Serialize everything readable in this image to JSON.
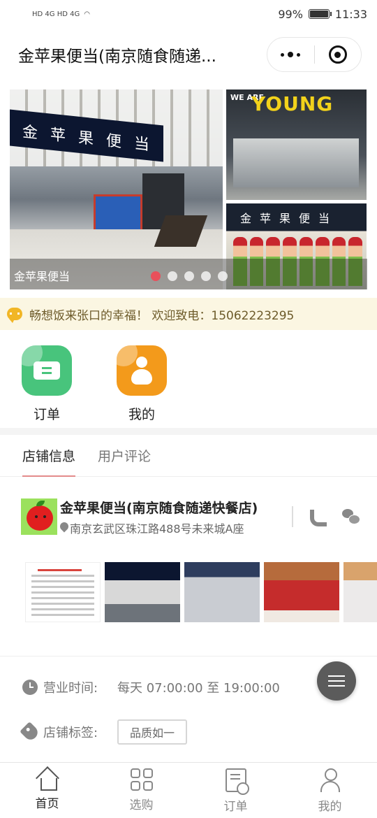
{
  "status_bar": {
    "carrier_left": "HD 4G HD 4G",
    "battery": "99%",
    "battery_level": 0.99,
    "time": "11:33"
  },
  "nav": {
    "title": "金苹果便当(南京随食随递..."
  },
  "banner": {
    "caption": "金苹果便当",
    "sign_text": "金苹果便当",
    "young_prefix": "WE ARE",
    "young_word": "YOUNG",
    "slide_count": 5,
    "active_slide": 1
  },
  "notice": {
    "text": "畅想饭来张口的幸福！ 欢迎致电：15062223295"
  },
  "quick_actions": [
    {
      "label": "订单",
      "icon": "ticket-icon"
    },
    {
      "label": "我的",
      "icon": "person-icon"
    }
  ],
  "tabs": [
    {
      "label": "店铺信息",
      "active": true
    },
    {
      "label": "用户评论",
      "active": false
    }
  ],
  "store": {
    "name": "金苹果便当(南京随食随递快餐店)",
    "address": "南京玄武区珠江路488号未来城A座"
  },
  "info": {
    "hours_label": "营业时间:",
    "hours_value": "每天 07:00:00 至 19:00:00",
    "tags_label": "店铺标签:",
    "tag": "品质如一"
  },
  "tabbar": [
    {
      "label": "首页",
      "icon": "home-icon",
      "active": true
    },
    {
      "label": "选购",
      "icon": "grid-icon",
      "active": false
    },
    {
      "label": "订单",
      "icon": "order-icon",
      "active": false
    },
    {
      "label": "我的",
      "icon": "user-icon",
      "active": false
    }
  ],
  "colors": {
    "accent": "#e8505b",
    "green_icon": "#48c47c",
    "orange_icon": "#f39a1b",
    "notice_bg": "#fbf6e2"
  }
}
